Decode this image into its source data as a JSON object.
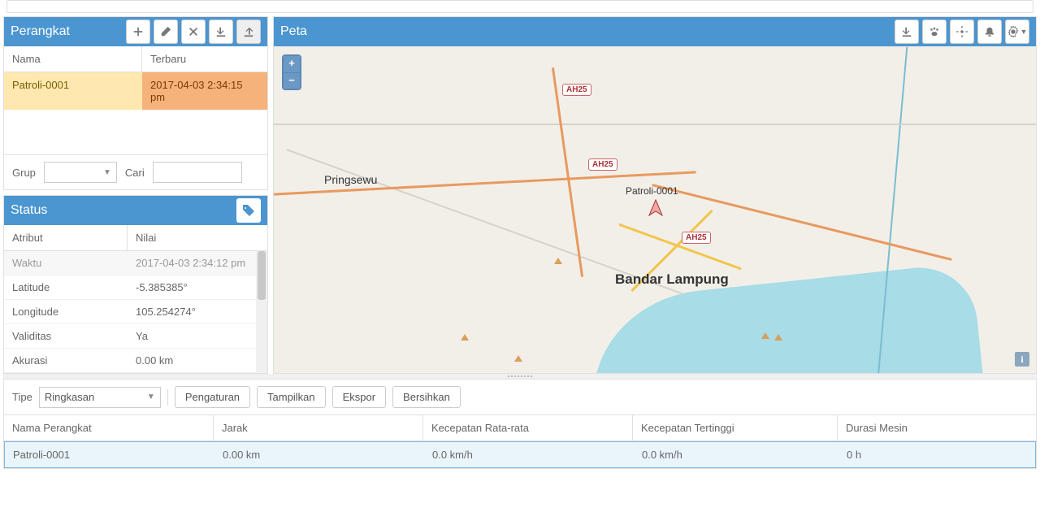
{
  "devices_panel": {
    "title": "Perangkat",
    "columns": {
      "name": "Nama",
      "latest": "Terbaru"
    },
    "rows": [
      {
        "name": "Patroli-0001",
        "latest": "2017-04-03 2:34:15 pm"
      }
    ],
    "footer": {
      "group_label": "Grup",
      "search_label": "Cari"
    }
  },
  "status_panel": {
    "title": "Status",
    "columns": {
      "attr": "Atribut",
      "value": "Nilai"
    },
    "rows": [
      {
        "attr": "Waktu",
        "value": "2017-04-03 2:34:12 pm"
      },
      {
        "attr": "Latitude",
        "value": "-5.385385°"
      },
      {
        "attr": "Longitude",
        "value": "105.254274°"
      },
      {
        "attr": "Validitas",
        "value": "Ya"
      },
      {
        "attr": "Akurasi",
        "value": "0.00 km"
      }
    ]
  },
  "map_panel": {
    "title": "Peta",
    "labels": {
      "pringsewu": "Pringsewu",
      "bandar_lampung": "Bandar Lampung",
      "device": "Patroli-0001",
      "shield1": "AH25",
      "shield2": "AH25",
      "shield3": "AH25"
    }
  },
  "bottom_panel": {
    "type_label": "Tipe",
    "type_value": "Ringkasan",
    "buttons": {
      "settings": "Pengaturan",
      "show": "Tampilkan",
      "export": "Ekspor",
      "clear": "Bersihkan"
    },
    "columns": {
      "device": "Nama Perangkat",
      "distance": "Jarak",
      "avgspeed": "Kecepatan Rata-rata",
      "topspeed": "Kecepatan Tertinggi",
      "engine": "Durasi Mesin"
    },
    "rows": [
      {
        "device": "Patroli-0001",
        "distance": "0.00 km",
        "avgspeed": "0.0 km/h",
        "topspeed": "0.0 km/h",
        "engine": "0 h"
      }
    ]
  }
}
